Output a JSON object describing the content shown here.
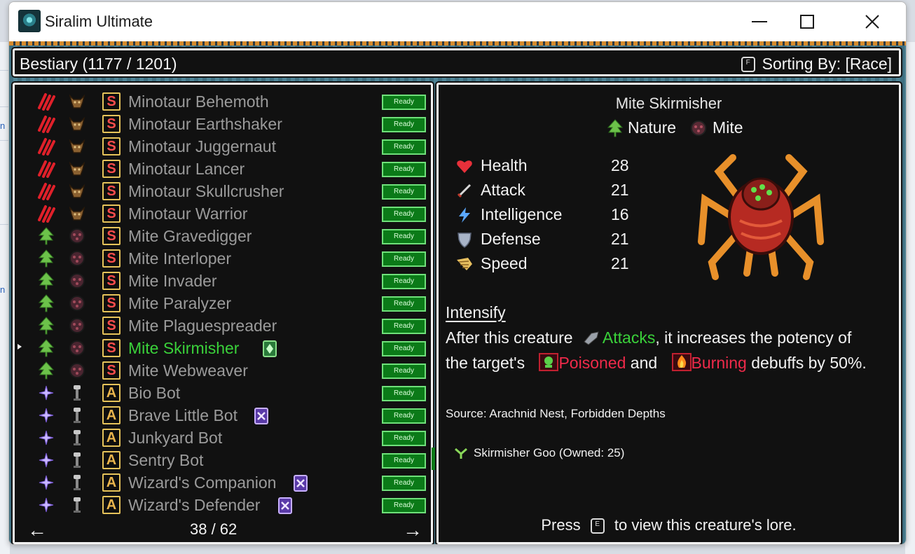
{
  "window": {
    "title": "Siralim Ultimate"
  },
  "header": {
    "title": "Bestiary (1177 / 1201)",
    "sort_key": "F",
    "sort_label": "Sorting By: [Race]"
  },
  "list": {
    "ready_label": "Ready",
    "rows": [
      {
        "name": "Minotaur Behemoth",
        "class": "chaos",
        "race": "minotaur",
        "rarity": "S",
        "badge": "",
        "selected": false
      },
      {
        "name": "Minotaur Earthshaker",
        "class": "chaos",
        "race": "minotaur",
        "rarity": "S",
        "badge": "",
        "selected": false
      },
      {
        "name": "Minotaur Juggernaut",
        "class": "chaos",
        "race": "minotaur",
        "rarity": "S",
        "badge": "",
        "selected": false
      },
      {
        "name": "Minotaur Lancer",
        "class": "chaos",
        "race": "minotaur",
        "rarity": "S",
        "badge": "",
        "selected": false
      },
      {
        "name": "Minotaur Skullcrusher",
        "class": "chaos",
        "race": "minotaur",
        "rarity": "S",
        "badge": "",
        "selected": false
      },
      {
        "name": "Minotaur Warrior",
        "class": "chaos",
        "race": "minotaur",
        "rarity": "S",
        "badge": "",
        "selected": false
      },
      {
        "name": "Mite Gravedigger",
        "class": "nature",
        "race": "mite",
        "rarity": "S",
        "badge": "",
        "selected": false
      },
      {
        "name": "Mite Interloper",
        "class": "nature",
        "race": "mite",
        "rarity": "S",
        "badge": "",
        "selected": false
      },
      {
        "name": "Mite Invader",
        "class": "nature",
        "race": "mite",
        "rarity": "S",
        "badge": "",
        "selected": false
      },
      {
        "name": "Mite Paralyzer",
        "class": "nature",
        "race": "mite",
        "rarity": "S",
        "badge": "",
        "selected": false
      },
      {
        "name": "Mite Plaguespreader",
        "class": "nature",
        "race": "mite",
        "rarity": "S",
        "badge": "",
        "selected": false
      },
      {
        "name": "Mite Skirmisher",
        "class": "nature",
        "race": "mite",
        "rarity": "S",
        "badge": "green-card",
        "selected": true
      },
      {
        "name": "Mite Webweaver",
        "class": "nature",
        "race": "mite",
        "rarity": "S",
        "badge": "",
        "selected": false
      },
      {
        "name": "Bio Bot",
        "class": "sorcery",
        "race": "bot",
        "rarity": "A",
        "badge": "",
        "selected": false
      },
      {
        "name": "Brave Little Bot",
        "class": "sorcery",
        "race": "bot",
        "rarity": "A",
        "badge": "purple-card",
        "selected": false
      },
      {
        "name": "Junkyard Bot",
        "class": "sorcery",
        "race": "bot",
        "rarity": "A",
        "badge": "",
        "selected": false
      },
      {
        "name": "Sentry Bot",
        "class": "sorcery",
        "race": "bot",
        "rarity": "A",
        "badge": "",
        "selected": false
      },
      {
        "name": "Wizard's Companion",
        "class": "sorcery",
        "race": "bot",
        "rarity": "A",
        "badge": "purple-card",
        "selected": false
      },
      {
        "name": "Wizard's Defender",
        "class": "sorcery",
        "race": "bot",
        "rarity": "A",
        "badge": "purple-card",
        "selected": false
      }
    ],
    "page": "38 / 62",
    "prev_arrow": "←",
    "next_arrow": "→"
  },
  "detail": {
    "name": "Mite Skirmisher",
    "class": "Nature",
    "race": "Mite",
    "stats": [
      {
        "label": "Health",
        "value": "28",
        "icon": "heart-icon"
      },
      {
        "label": "Attack",
        "value": "21",
        "icon": "sword-icon"
      },
      {
        "label": "Intelligence",
        "value": "16",
        "icon": "lightning-icon"
      },
      {
        "label": "Defense",
        "value": "21",
        "icon": "shield-icon"
      },
      {
        "label": "Speed",
        "value": "21",
        "icon": "wing-icon"
      }
    ],
    "trait": {
      "title": "Intensify",
      "line1_pre": "After this creature ",
      "line1_link": "Attacks",
      "line1_post": ", it increases the potency of",
      "line2_pre": "the target's ",
      "poisoned": "Poisoned",
      "and": " and ",
      "burning": "Burning",
      "line2_post": " debuffs by 50%."
    },
    "source": "Source: Arachnid Nest, Forbidden Depths",
    "material": "Skirmisher Goo (Owned: 25)",
    "lore_pre": "Press",
    "lore_key": "E",
    "lore_post": "to view this creature's lore."
  },
  "colors": {
    "selected": "#3ad13a",
    "ready_bg": "#0b7a18",
    "debuff": "#ef2a4a",
    "panel": "#111111"
  }
}
